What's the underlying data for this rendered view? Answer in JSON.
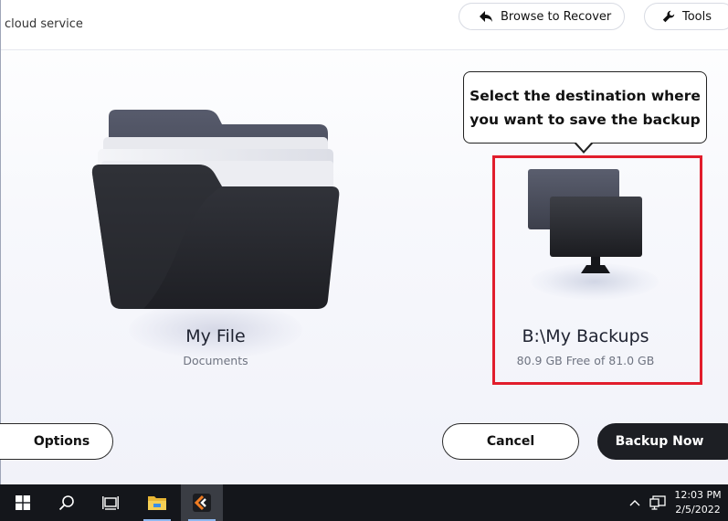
{
  "header": {
    "service_text": "cloud service",
    "browse_label": "Browse to Recover",
    "tools_label": "Tools"
  },
  "source": {
    "title": "My File",
    "subtitle": "Documents"
  },
  "destination": {
    "tooltip_line1": "Select the destination where",
    "tooltip_line2": "you want to save the backup",
    "title": "B:\\My Backups",
    "subtitle": "80.9 GB Free of 81.0 GB"
  },
  "footer": {
    "options_label": "Options",
    "cancel_label": "Cancel",
    "backup_label": "Backup Now"
  },
  "taskbar": {
    "time": "12:03 PM",
    "date": "2/5/2022",
    "icons": [
      "windows-start-icon",
      "search-icon",
      "task-view-icon",
      "file-explorer-icon",
      "backup-app-icon",
      "chevron-up-icon",
      "network-icon"
    ]
  },
  "colors": {
    "highlight": "#e11d2c",
    "primary_button": "#1d1f24",
    "taskbar": "#14161b"
  }
}
